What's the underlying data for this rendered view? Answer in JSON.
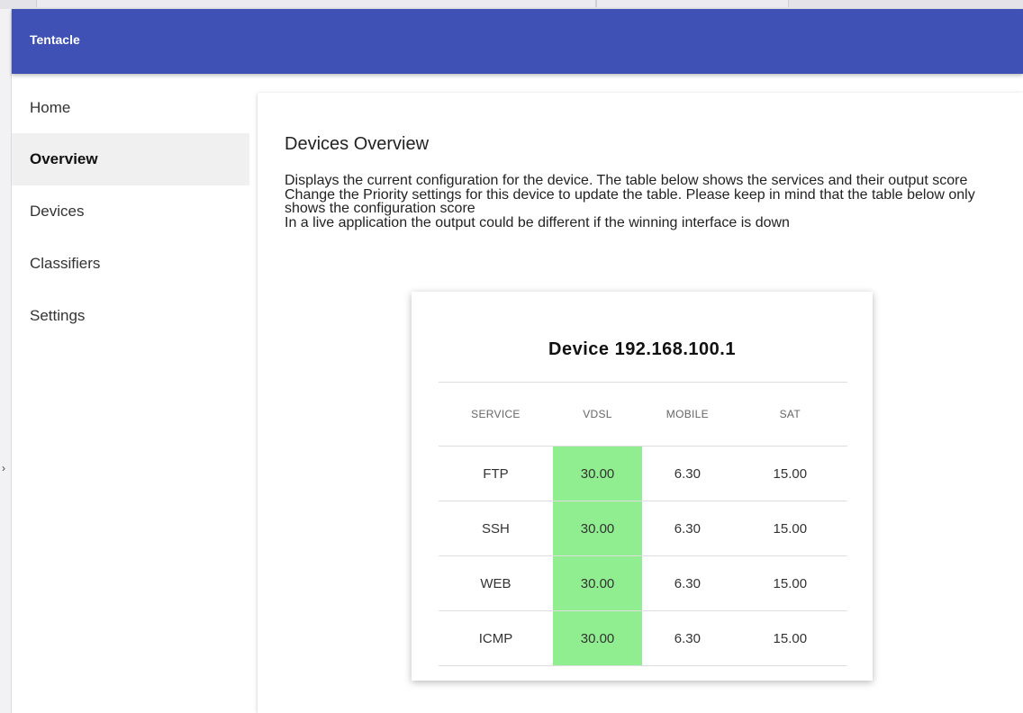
{
  "app": {
    "title": "Tentacle"
  },
  "sidebar": {
    "items": [
      {
        "label": "Home",
        "active": false
      },
      {
        "label": "Overview",
        "active": true
      },
      {
        "label": "Devices",
        "active": false
      },
      {
        "label": "Classifiers",
        "active": false
      },
      {
        "label": "Settings",
        "active": false
      }
    ]
  },
  "main": {
    "title": "Devices Overview",
    "description": [
      "Displays the current configuration for the device. The table below shows the services and their output score",
      "Change the Priority settings for this device to update the table. Please keep in mind that the table below only shows the configuration score",
      "In a live application the output could be different if the winning interface is down"
    ]
  },
  "device": {
    "title": "Device 192.168.100.1",
    "columns": [
      "SERVICE",
      "VDSL",
      "MOBILE",
      "SAT"
    ],
    "rows": [
      {
        "service": "FTP",
        "vdsl": "30.00",
        "mobile": "6.30",
        "sat": "15.00",
        "winner": "vdsl"
      },
      {
        "service": "SSH",
        "vdsl": "30.00",
        "mobile": "6.30",
        "sat": "15.00",
        "winner": "vdsl"
      },
      {
        "service": "WEB",
        "vdsl": "30.00",
        "mobile": "6.30",
        "sat": "15.00",
        "winner": "vdsl"
      },
      {
        "service": "ICMP",
        "vdsl": "30.00",
        "mobile": "6.30",
        "sat": "15.00",
        "winner": "vdsl"
      }
    ]
  },
  "colors": {
    "appbar": "#3f51b5",
    "winner_cell": "#90ee90",
    "active_nav_bg": "#f0f0f0"
  }
}
